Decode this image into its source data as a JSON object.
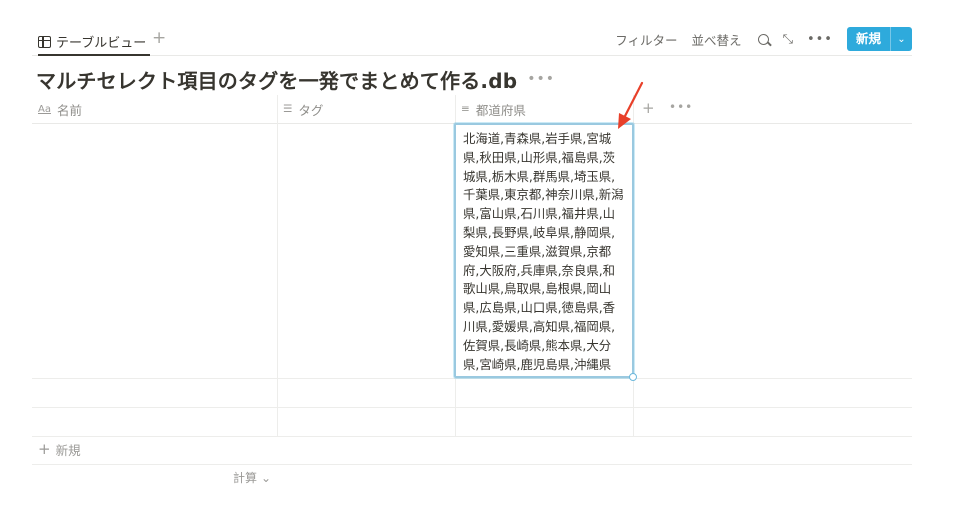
{
  "toolbar": {
    "view_tab_label": "テーブルビュー",
    "add_view_symbol": "+",
    "filter_label": "フィルター",
    "sort_label": "並べ替え",
    "expand_symbol": "⤡",
    "more_symbol": "•••",
    "new_button_label": "新規",
    "new_dropdown_symbol": "⌄"
  },
  "database": {
    "title": "マルチセレクト項目のタグを一発でまとめて作る.db",
    "more_symbol": "•••"
  },
  "columns": [
    {
      "label": "名前",
      "icon": "Aa"
    },
    {
      "label": "タグ",
      "icon": "☰"
    },
    {
      "label": "都道府県",
      "icon": "≡"
    }
  ],
  "header_add_symbol": "+",
  "header_more_symbol": "•••",
  "editing_cell": {
    "value": "北海道,青森県,岩手県,宮城県,秋田県,山形県,福島県,茨城県,栃木県,群馬県,埼玉県,千葉県,東京都,神奈川県,新潟県,富山県,石川県,福井県,山梨県,長野県,岐阜県,静岡県,愛知県,三重県,滋賀県,京都府,大阪府,兵庫県,奈良県,和歌山県,鳥取県,島根県,岡山県,広島県,山口県,徳島県,香川県,愛媛県,高知県,福岡県,佐賀県,長崎県,熊本県,大分県,宮崎県,鹿児島県,沖縄県"
  },
  "footer": {
    "add_row_symbol": "+",
    "add_row_label": "新規",
    "calc_label": "計算",
    "calc_chevron": "⌄"
  },
  "colors": {
    "accent": "#2eaadc",
    "annotation_arrow": "#e8402a",
    "text": "#37352f",
    "muted": "#9b9a97"
  }
}
